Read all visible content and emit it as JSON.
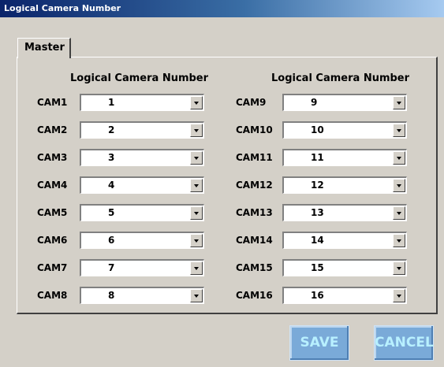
{
  "window": {
    "title": "Logical Camera Number"
  },
  "tabs": [
    {
      "label": "Master"
    }
  ],
  "columns": [
    {
      "header": "Logical Camera Number",
      "rows": [
        {
          "label": "CAM1",
          "value": "1"
        },
        {
          "label": "CAM2",
          "value": "2"
        },
        {
          "label": "CAM3",
          "value": "3"
        },
        {
          "label": "CAM4",
          "value": "4"
        },
        {
          "label": "CAM5",
          "value": "5"
        },
        {
          "label": "CAM6",
          "value": "6"
        },
        {
          "label": "CAM7",
          "value": "7"
        },
        {
          "label": "CAM8",
          "value": "8"
        }
      ]
    },
    {
      "header": "Logical Camera Number",
      "rows": [
        {
          "label": "CAM9",
          "value": "9"
        },
        {
          "label": "CAM10",
          "value": "10"
        },
        {
          "label": "CAM11",
          "value": "11"
        },
        {
          "label": "CAM12",
          "value": "12"
        },
        {
          "label": "CAM13",
          "value": "13"
        },
        {
          "label": "CAM14",
          "value": "14"
        },
        {
          "label": "CAM15",
          "value": "15"
        },
        {
          "label": "CAM16",
          "value": "16"
        }
      ]
    }
  ],
  "buttons": {
    "save": "SAVE",
    "cancel": "CANCEL"
  },
  "colors": {
    "title_bar_start": "#0a246a",
    "title_bar_end": "#a6caf0",
    "button_bg": "#7aaad8",
    "button_text": "#b8f0ff"
  },
  "icons": {
    "dropdown": "chevron-down-icon"
  }
}
